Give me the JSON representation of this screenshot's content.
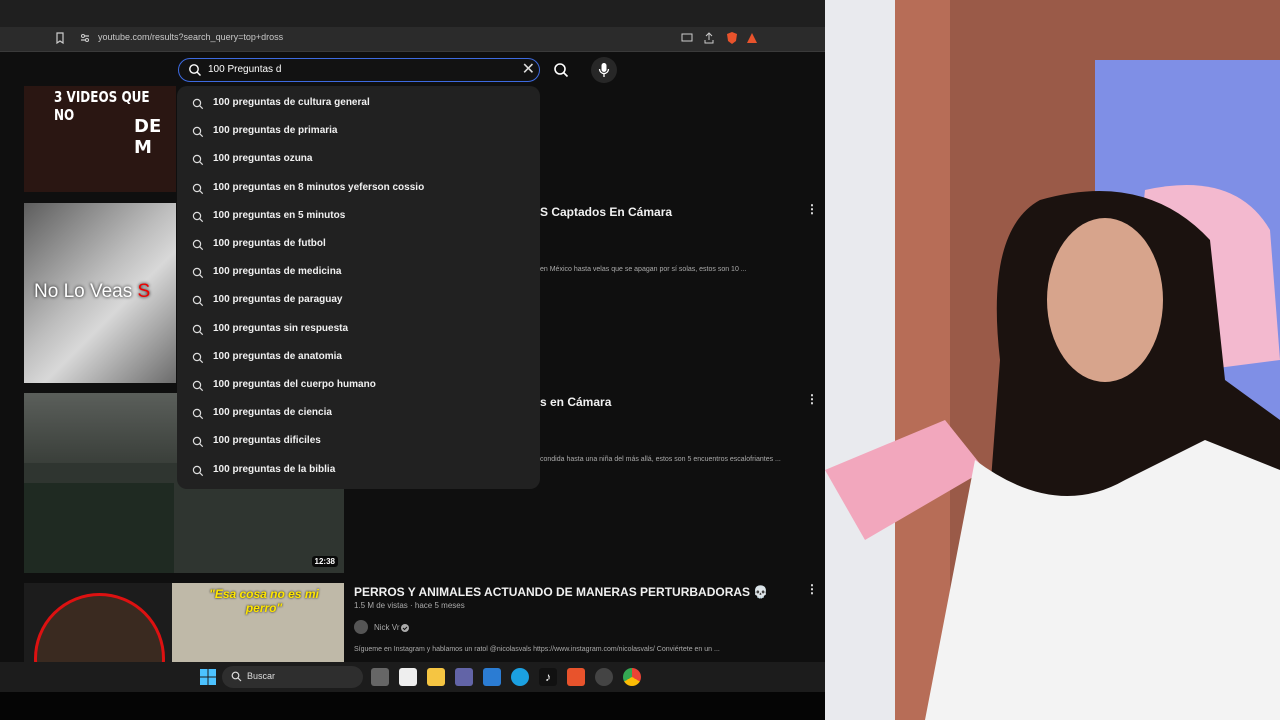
{
  "browser": {
    "url": "youtube.com/results?search_query=top+dross"
  },
  "search": {
    "value": "100 Preguntas d",
    "suggestions": [
      "100 preguntas de cultura general",
      "100 preguntas de primaria",
      "100 preguntas ozuna",
      "100 preguntas en 8 minutos yeferson cossio",
      "100 preguntas en 5 minutos",
      "100 preguntas de futbol",
      "100 preguntas de medicina",
      "100 preguntas de paraguay",
      "100 preguntas sin respuesta",
      "100 preguntas de anatomia",
      "100 preguntas del cuerpo humano",
      "100 preguntas de ciencia",
      "100 preguntas dificiles",
      "100 preguntas de la biblia"
    ]
  },
  "results": {
    "v1": {
      "thumb_text": "3 VIDEOS QUE NO",
      "thumb_text2": "DE M"
    },
    "v2": {
      "title_tail": "S Captados En Cámara",
      "desc_tail": "en México hasta velas que se apagan por sí solas, estos son 10 ...",
      "thumb_text": "No Lo Veas",
      "thumb_text_red": "S"
    },
    "v3": {
      "title_tail": "s en Cámara",
      "desc_tail": "condida hasta una niña del más allá, estos son 5 encuentros escalofriantes ...",
      "duration": "12:38"
    },
    "v4": {
      "title": "PERROS Y ANIMALES ACTUANDO DE MANERAS PERTURBADORAS 💀",
      "meta": "1.5 M de vistas · hace 5 meses",
      "channel": "Nick Vr",
      "desc": "Sígueme en Instagram y hablamos un ratol @nicolasvals https://www.instagram.com/nicolasvals/ Conviértete en un ...",
      "thumb_text": "\"Esa cosa no es mi perro\""
    }
  },
  "taskbar": {
    "search_label": "Buscar"
  },
  "colors": {
    "accent": "#3d6ae0",
    "youtube_red": "#ff0000",
    "dark_bg": "#0f0f0f"
  }
}
